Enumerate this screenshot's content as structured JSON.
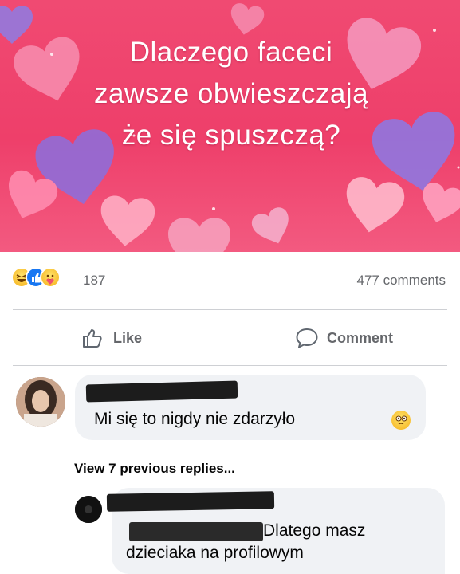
{
  "post": {
    "banner_lines": [
      "Dlaczego faceci",
      "zawsze obwieszczają",
      "że się spuszczą?"
    ],
    "banner_color": "#ee3f6a"
  },
  "reactions": {
    "icons": [
      "haha-icon",
      "like-icon",
      "care-icon"
    ],
    "count": "187",
    "comments_count": "477 comments"
  },
  "actions": {
    "like_label": "Like",
    "comment_label": "Comment"
  },
  "comments": [
    {
      "author_redacted": true,
      "text": "Mi się to nigdy nie zdarzyło",
      "trailing_emoji": "emoji-face-icon"
    }
  ],
  "view_replies_label": "View 7 previous replies...",
  "reply": {
    "author_redacted": true,
    "line1": "Dlatego masz",
    "line2": "dzieciaka na profilowym"
  }
}
